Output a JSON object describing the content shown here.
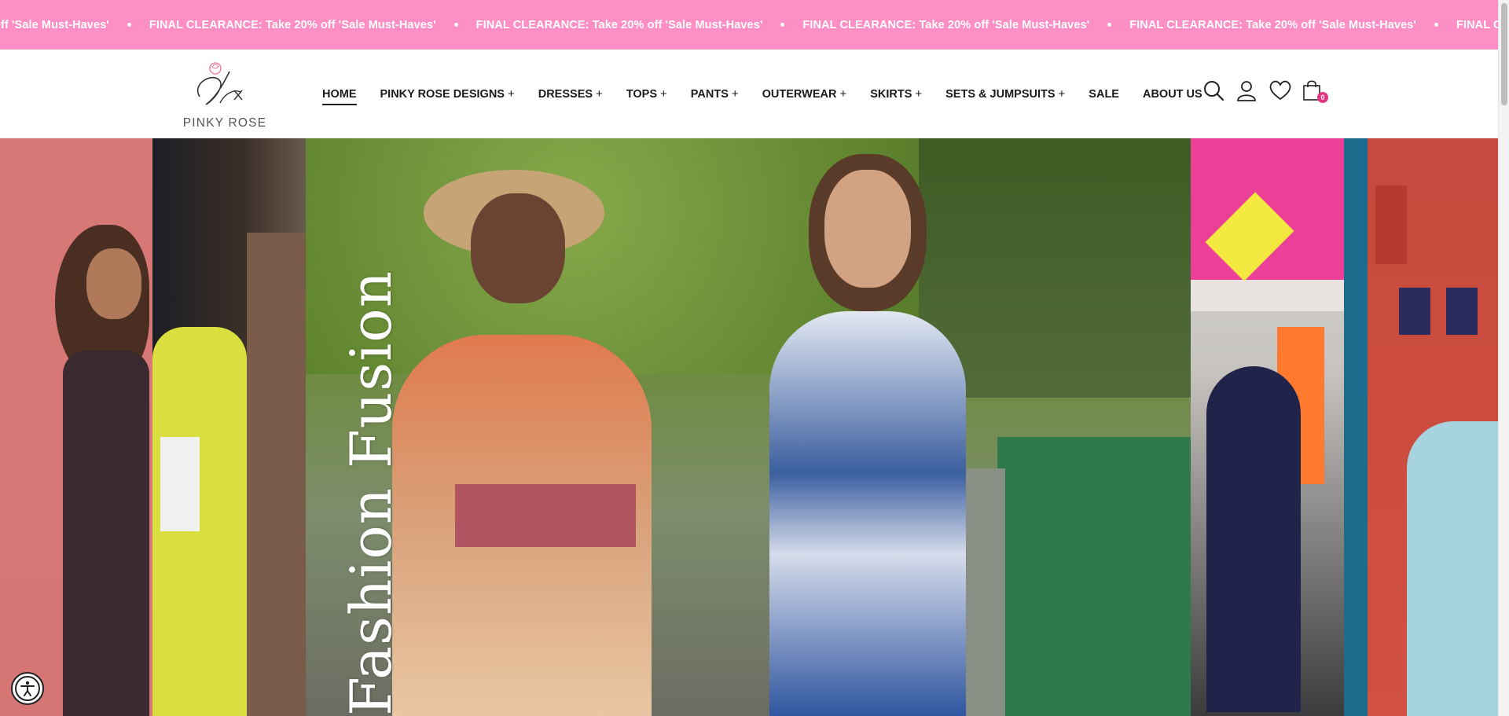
{
  "announcement": {
    "text": "FINAL CLEARANCE: Take 20% off 'Sale Must-Haves'",
    "leading_fragment": "ake 20% off 'Sale Must-Haves'"
  },
  "header": {
    "logo_text": "PINKY ROSE",
    "nav": [
      {
        "label": "HOME",
        "has_plus": false,
        "active": true
      },
      {
        "label": "PINKY ROSE DESIGNS",
        "has_plus": true
      },
      {
        "label": "DRESSES",
        "has_plus": true
      },
      {
        "label": "TOPS",
        "has_plus": true
      },
      {
        "label": "PANTS",
        "has_plus": true
      },
      {
        "label": "OUTERWEAR",
        "has_plus": true
      },
      {
        "label": "SKIRTS",
        "has_plus": true
      },
      {
        "label": "SETS & JUMPSUITS",
        "has_plus": true
      },
      {
        "label": "SALE",
        "has_plus": false
      },
      {
        "label": "ABOUT US",
        "has_plus": false
      }
    ],
    "plus_symbol": "+",
    "icons": [
      "search-icon",
      "account-icon",
      "wishlist-icon",
      "cart-icon"
    ],
    "cart_count": "0"
  },
  "hero": {
    "title": "Fashion Fusion"
  },
  "colors": {
    "announcement_bg": "#fe8fc4",
    "badge": "#e6337f"
  }
}
